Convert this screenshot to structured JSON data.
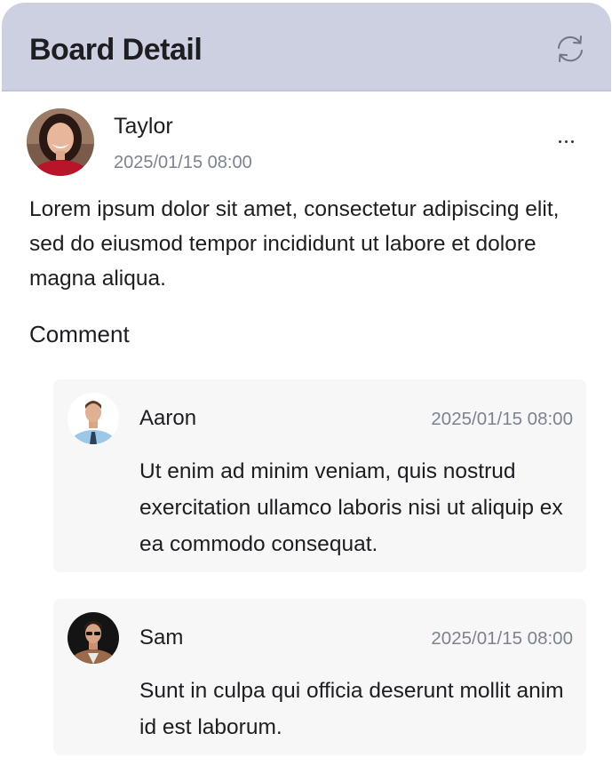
{
  "header": {
    "title": "Board Detail",
    "refresh_icon": "refresh-icon"
  },
  "post": {
    "author": "Taylor",
    "date": "2025/01/15 08:00",
    "body": "Lorem ipsum dolor sit amet, consectetur adipiscing elit, sed do eiusmod tempor incididunt ut labore et dolore magna aliqua.",
    "more_icon": "more-horizontal-icon"
  },
  "comments_section": {
    "heading": "Comment",
    "items": [
      {
        "author": "Aaron",
        "date": "2025/01/15 08:00",
        "text": "Ut enim ad minim veniam, quis nostrud exercitation ullamco laboris nisi ut aliquip ex ea commodo consequat."
      },
      {
        "author": "Sam",
        "date": "2025/01/15 08:00",
        "text": "Sunt in culpa qui officia deserunt mollit anim id est laborum."
      }
    ]
  },
  "colors": {
    "header_bg": "#cdd0e1",
    "comment_bg": "#f7f7f8",
    "muted_text": "#7c8390"
  }
}
